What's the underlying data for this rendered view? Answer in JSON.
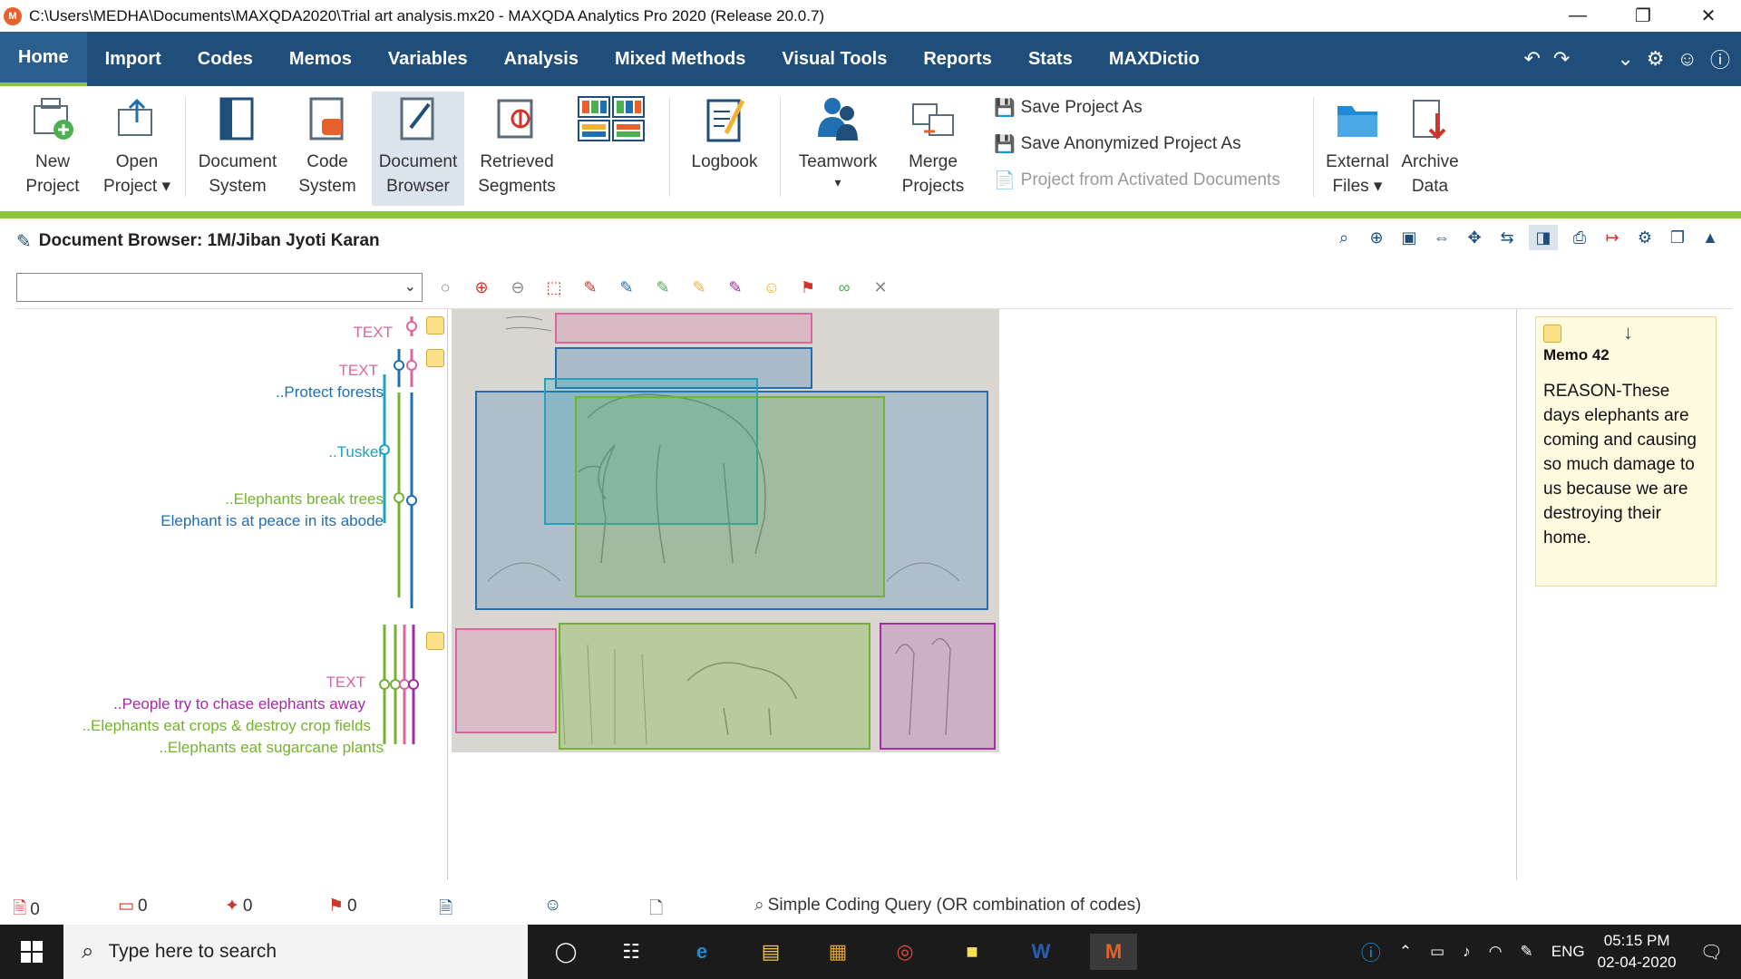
{
  "window": {
    "title": "C:\\Users\\MEDHA\\Documents\\MAXQDA2020\\Trial art analysis.mx20 - MAXQDA Analytics Pro 2020 (Release 20.0.7)"
  },
  "menu": {
    "items": [
      "Home",
      "Import",
      "Codes",
      "Memos",
      "Variables",
      "Analysis",
      "Mixed Methods",
      "Visual Tools",
      "Reports",
      "Stats",
      "MAXDictio"
    ],
    "active": "Home"
  },
  "ribbon": {
    "new_project": [
      "New",
      "Project"
    ],
    "open_project": [
      "Open",
      "Project"
    ],
    "document_system": [
      "Document",
      "System"
    ],
    "code_system": [
      "Code",
      "System"
    ],
    "document_browser": [
      "Document",
      "Browser"
    ],
    "retrieved_segments": [
      "Retrieved",
      "Segments"
    ],
    "logbook": "Logbook",
    "teamwork": "Teamwork",
    "merge_projects": [
      "Merge",
      "Projects"
    ],
    "save_project_as": "Save Project As",
    "save_anonymized": "Save Anonymized Project As",
    "project_from_activated": "Project from Activated Documents",
    "external_files": [
      "External",
      "Files"
    ],
    "archive_data": [
      "Archive",
      "Data"
    ]
  },
  "document": {
    "title": "Document Browser: 1M/Jiban Jyoti Karan",
    "dropdown_value": ""
  },
  "codes": {
    "labels": [
      {
        "text": "TEXT",
        "color": "#d9669e"
      },
      {
        "text": "TEXT",
        "color": "#d9669e"
      },
      {
        "text": "..Protect forests",
        "color": "#1f6fb2"
      },
      {
        "text": "..Tusker",
        "color": "#1aa5b8"
      },
      {
        "text": "..Elephants break trees",
        "color": "#74b32e"
      },
      {
        "text": "Elephant is at peace in its abode",
        "color": "#1f6fb2"
      },
      {
        "text": "TEXT",
        "color": "#d9669e"
      },
      {
        "text": "..People try to chase elephants away",
        "color": "#a32ca6"
      },
      {
        "text": "..Elephants eat crops & destroy crop fields",
        "color": "#74b32e"
      },
      {
        "text": "..Elephants eat sugarcane plants",
        "color": "#74b32e"
      }
    ]
  },
  "memo": {
    "title": "Memo 42",
    "body": "REASON-These days elephants are coming and causing so much damage to us because we are destroying their home."
  },
  "status": {
    "count1": "0",
    "count2": "0",
    "count3": "0",
    "count4": "0",
    "query": "Simple Coding Query (OR combination of codes)"
  },
  "taskbar": {
    "search_placeholder": "Type here to search",
    "lang": "ENG",
    "time": "05:15 PM",
    "date": "02-04-2020"
  },
  "colors": {
    "menubar": "#1e4e79",
    "accent_green": "#8cc63f",
    "pink": "#d9669e",
    "blue": "#1f6fb2",
    "cyan": "#1aa5b8",
    "green": "#74b32e",
    "purple": "#a32ca6"
  }
}
